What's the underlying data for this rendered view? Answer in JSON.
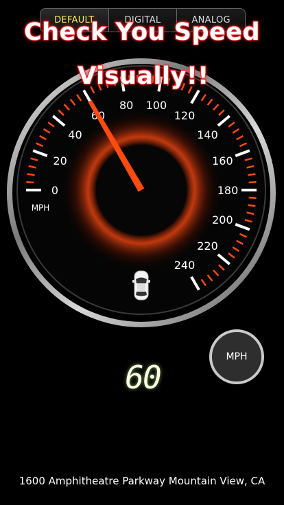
{
  "tabs": [
    {
      "label": "DEFAULT",
      "active": true
    },
    {
      "label": "DIGITAL",
      "active": false
    },
    {
      "label": "ANALOG",
      "active": false
    }
  ],
  "promo": {
    "line1": "Check You Speed",
    "line2": "Visually!!"
  },
  "gauge": {
    "unit_label": "MPH",
    "min": 0,
    "max": 240,
    "major_step": 20,
    "tick_labels": [
      "0",
      "20",
      "40",
      "60",
      "80",
      "100",
      "120",
      "140",
      "160",
      "180",
      "200",
      "220",
      "240"
    ],
    "needle_value": 60,
    "car_icon": "car-top-view-icon",
    "colors": {
      "needle": "#ff4a12",
      "minor_ticks": "#ff4a12",
      "major_ticks": "#ffffff",
      "glow": "#ff4a12"
    }
  },
  "unit_toggle": {
    "label": "MPH"
  },
  "speed_readout": "60",
  "address": "1600 Amphitheatre Parkway Mountain View, CA"
}
